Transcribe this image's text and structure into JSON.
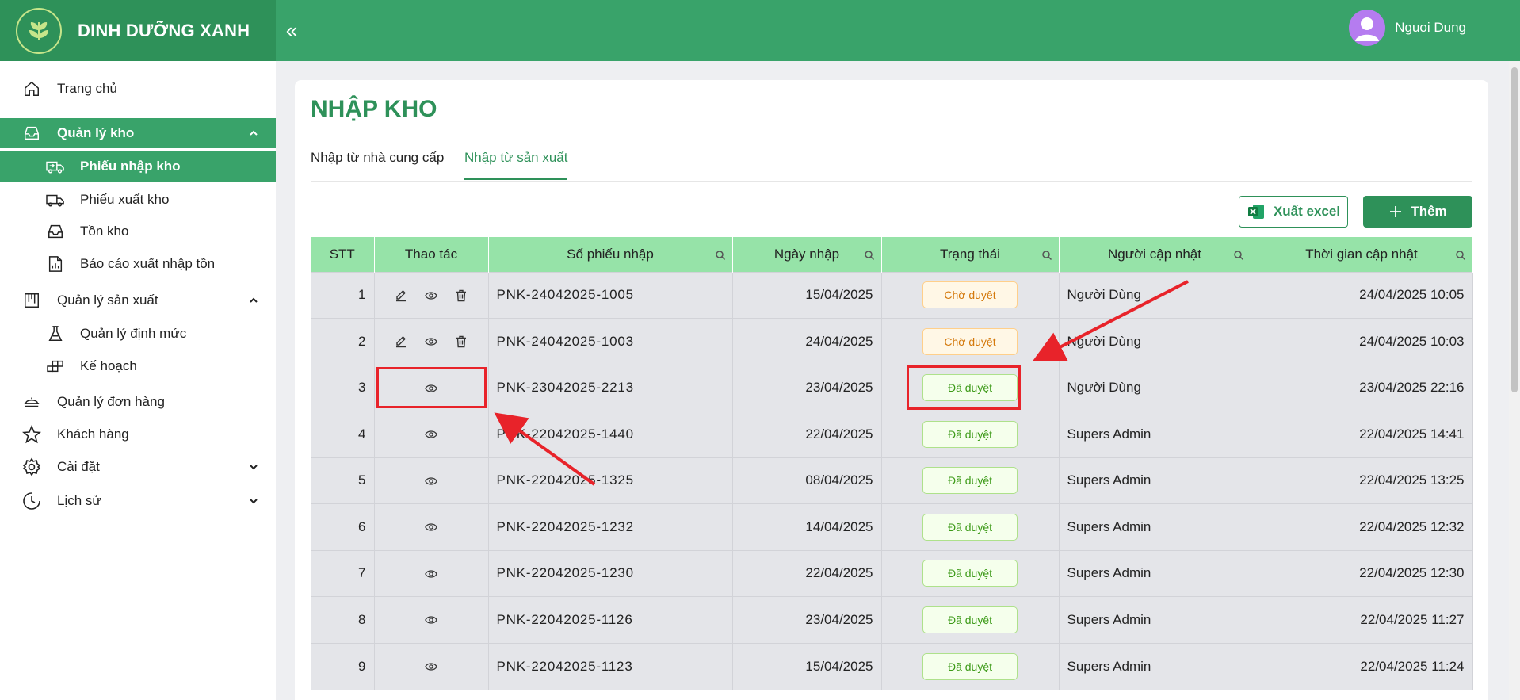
{
  "brand": {
    "name": "DINH DƯỠNG XANH"
  },
  "user": {
    "name": "Nguoi Dung"
  },
  "sidebar": {
    "home": "Trang chủ",
    "warehouse": "Quản lý kho",
    "receipt": "Phiếu nhập kho",
    "issue": "Phiếu xuất kho",
    "stock": "Tồn kho",
    "report": "Báo cáo xuất nhập tồn",
    "production": "Quản lý sản xuất",
    "norms": "Quản lý định mức",
    "plan": "Kế hoạch",
    "orders": "Quản lý đơn hàng",
    "customers": "Khách hàng",
    "settings": "Cài đặt",
    "history": "Lịch sử"
  },
  "page": {
    "title": "NHẬP KHO",
    "tab_supplier": "Nhập từ nhà cung cấp",
    "tab_production": "Nhập từ sản xuất",
    "export_label": "Xuất excel",
    "add_label": "Thêm"
  },
  "table": {
    "headers": [
      "STT",
      "Thao tác",
      "Số phiếu nhập",
      "Ngày nhập",
      "Trạng thái",
      "Người cập nhật",
      "Thời gian cập nhật"
    ],
    "rows": [
      {
        "stt": "1",
        "code": "PNK-24042025-1005",
        "date": "15/04/2025",
        "status": "Chờ duyệt",
        "user": "Người Dùng",
        "time": "24/04/2025 10:05"
      },
      {
        "stt": "2",
        "code": "PNK-24042025-1003",
        "date": "24/04/2025",
        "status": "Chờ duyệt",
        "user": "Người Dùng",
        "time": "24/04/2025 10:03"
      },
      {
        "stt": "3",
        "code": "PNK-23042025-2213",
        "date": "23/04/2025",
        "status": "Đã duyệt",
        "user": "Người Dùng",
        "time": "23/04/2025 22:16"
      },
      {
        "stt": "4",
        "code": "PNK-22042025-1440",
        "date": "22/04/2025",
        "status": "Đã duyệt",
        "user": "Supers Admin",
        "time": "22/04/2025 14:41"
      },
      {
        "stt": "5",
        "code": "PNK-22042025-1325",
        "date": "08/04/2025",
        "status": "Đã duyệt",
        "user": "Supers Admin",
        "time": "22/04/2025 13:25"
      },
      {
        "stt": "6",
        "code": "PNK-22042025-1232",
        "date": "14/04/2025",
        "status": "Đã duyệt",
        "user": "Supers Admin",
        "time": "22/04/2025 12:32"
      },
      {
        "stt": "7",
        "code": "PNK-22042025-1230",
        "date": "22/04/2025",
        "status": "Đã duyệt",
        "user": "Supers Admin",
        "time": "22/04/2025 12:30"
      },
      {
        "stt": "8",
        "code": "PNK-22042025-1126",
        "date": "23/04/2025",
        "status": "Đã duyệt",
        "user": "Supers Admin",
        "time": "22/04/2025 11:27"
      },
      {
        "stt": "9",
        "code": "PNK-22042025-1123",
        "date": "15/04/2025",
        "status": "Đã duyệt",
        "user": "Supers Admin",
        "time": "22/04/2025 11:24"
      }
    ]
  },
  "colors": {
    "primary": "#2e9159",
    "header": "#39a36a",
    "table_header": "#96e3a8",
    "annotation": "#e8232a"
  }
}
